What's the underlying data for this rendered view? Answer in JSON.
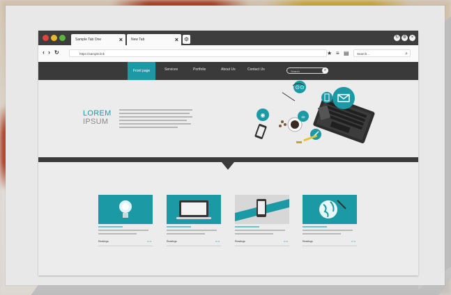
{
  "browser": {
    "tabs": [
      {
        "label": "Sample Tab One"
      },
      {
        "label": "New Tab"
      }
    ],
    "new_tab_icon": "gear-icon",
    "url": "https://sample.link",
    "search_placeholder": "Search..."
  },
  "site": {
    "nav": [
      {
        "label": "Front page",
        "active": true
      },
      {
        "label": "Services",
        "active": false
      },
      {
        "label": "Portfolio",
        "active": false
      },
      {
        "label": "About Us",
        "active": false
      },
      {
        "label": "Contact Us",
        "active": false
      }
    ],
    "search_placeholder": "Search",
    "hero": {
      "title_line1": "LOREM",
      "title_line2": "IPSUM"
    },
    "cards": [
      {
        "icon": "lightbulb-icon",
        "footer_left": "Readings",
        "footer_right": "•• ••"
      },
      {
        "icon": "monitor-icon",
        "footer_left": "Readings",
        "footer_right": "•• ••"
      },
      {
        "icon": "smartphone-icon",
        "footer_left": "Readings",
        "footer_right": "•• ••"
      },
      {
        "icon": "globe-icon",
        "footer_left": "Readings",
        "footer_right": "•• ••"
      }
    ]
  },
  "colors": {
    "accent": "#1b9aa5",
    "dark": "#3a3a3a",
    "traffic_red": "#e0443e",
    "traffic_yellow": "#e8b92a",
    "traffic_green": "#5db53c"
  }
}
